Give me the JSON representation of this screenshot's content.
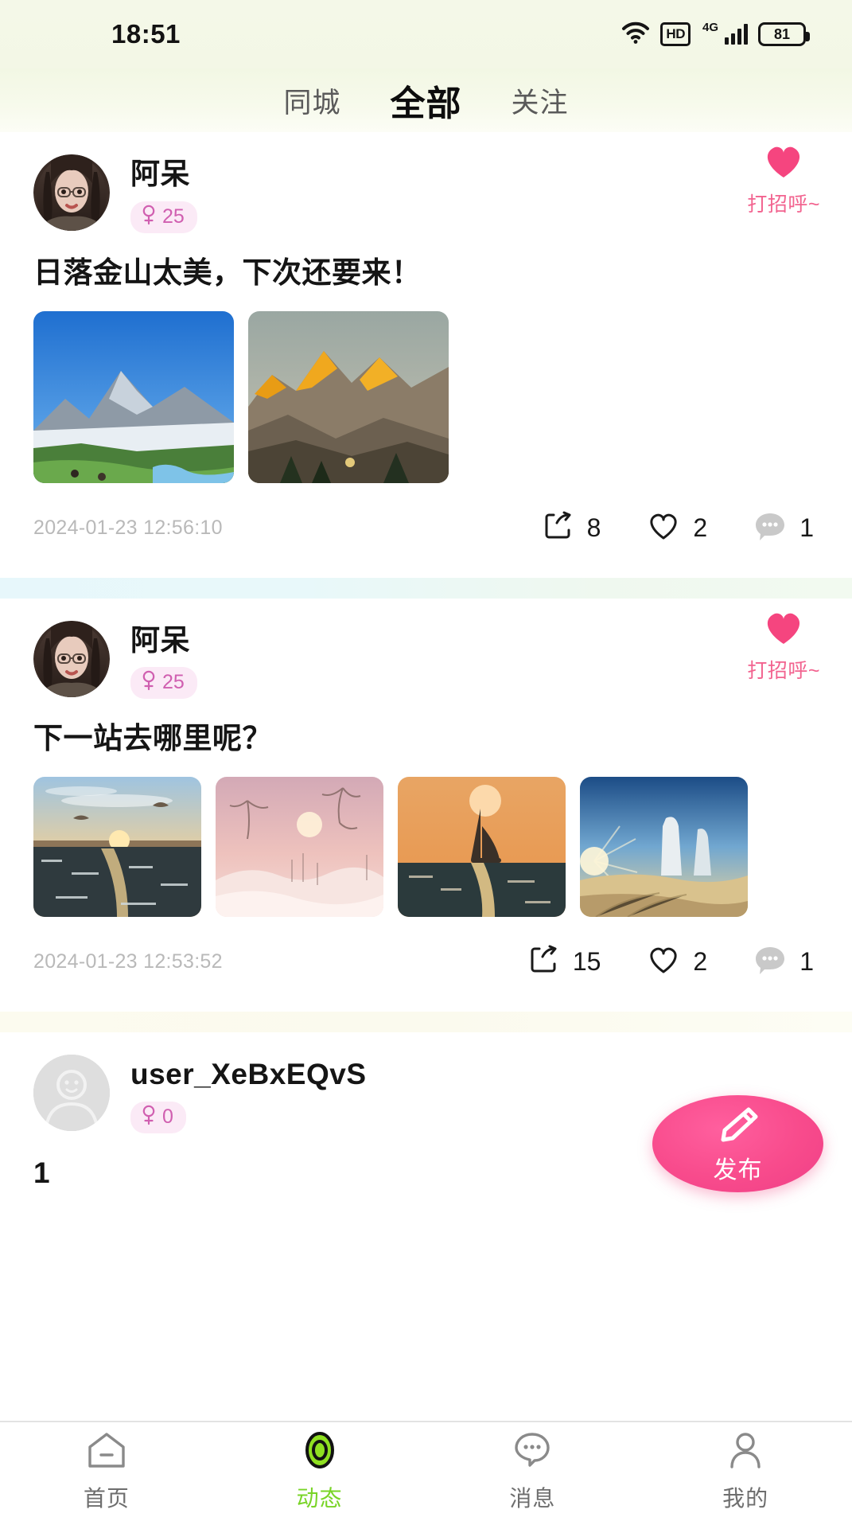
{
  "status_bar": {
    "time": "18:51",
    "wifi_icon": "wifi-icon",
    "hd_label": "HD",
    "network_label": "4G",
    "signal_icon": "signal-bars-icon",
    "battery_level": "81"
  },
  "tabs": [
    {
      "label": "同城",
      "active": false
    },
    {
      "label": "全部",
      "active": true
    },
    {
      "label": "关注",
      "active": false
    }
  ],
  "posts": [
    {
      "user_name": "阿呆",
      "gender_icon": "female-icon",
      "age": "25",
      "avatar_type": "photo",
      "greet_label": "打招呼~",
      "greet_icon": "heart-filled-icon",
      "text": "日落金山太美，下次还要来！",
      "image_count": 2,
      "timestamp": "2024-01-23 12:56:10",
      "share_count": "8",
      "like_count": "2",
      "comment_count": "1"
    },
    {
      "user_name": "阿呆",
      "gender_icon": "female-icon",
      "age": "25",
      "avatar_type": "photo",
      "greet_label": "打招呼~",
      "greet_icon": "heart-filled-icon",
      "text": "下一站去哪里呢？",
      "image_count": 4,
      "timestamp": "2024-01-23 12:53:52",
      "share_count": "15",
      "like_count": "2",
      "comment_count": "1"
    },
    {
      "user_name": "user_XeBxEQvS",
      "gender_icon": "female-icon",
      "age": "0",
      "avatar_type": "default",
      "greet_label": "",
      "greet_icon": "",
      "text": "1",
      "image_count": 0,
      "timestamp": "",
      "share_count": "",
      "like_count": "",
      "comment_count": ""
    }
  ],
  "fab": {
    "label": "发布",
    "icon": "pencil-icon",
    "color": "#f84b8c"
  },
  "bottom_nav": {
    "active_color": "#79d427",
    "items": [
      {
        "label": "首页",
        "icon": "home-icon",
        "active": false
      },
      {
        "label": "动态",
        "icon": "moments-circle-icon",
        "active": true
      },
      {
        "label": "消息",
        "icon": "message-bubble-icon",
        "active": false
      },
      {
        "label": "我的",
        "icon": "person-icon",
        "active": false
      }
    ]
  },
  "action_icons": {
    "share": "share-icon",
    "like": "heart-outline-icon",
    "comment": "comment-bubble-icon"
  }
}
